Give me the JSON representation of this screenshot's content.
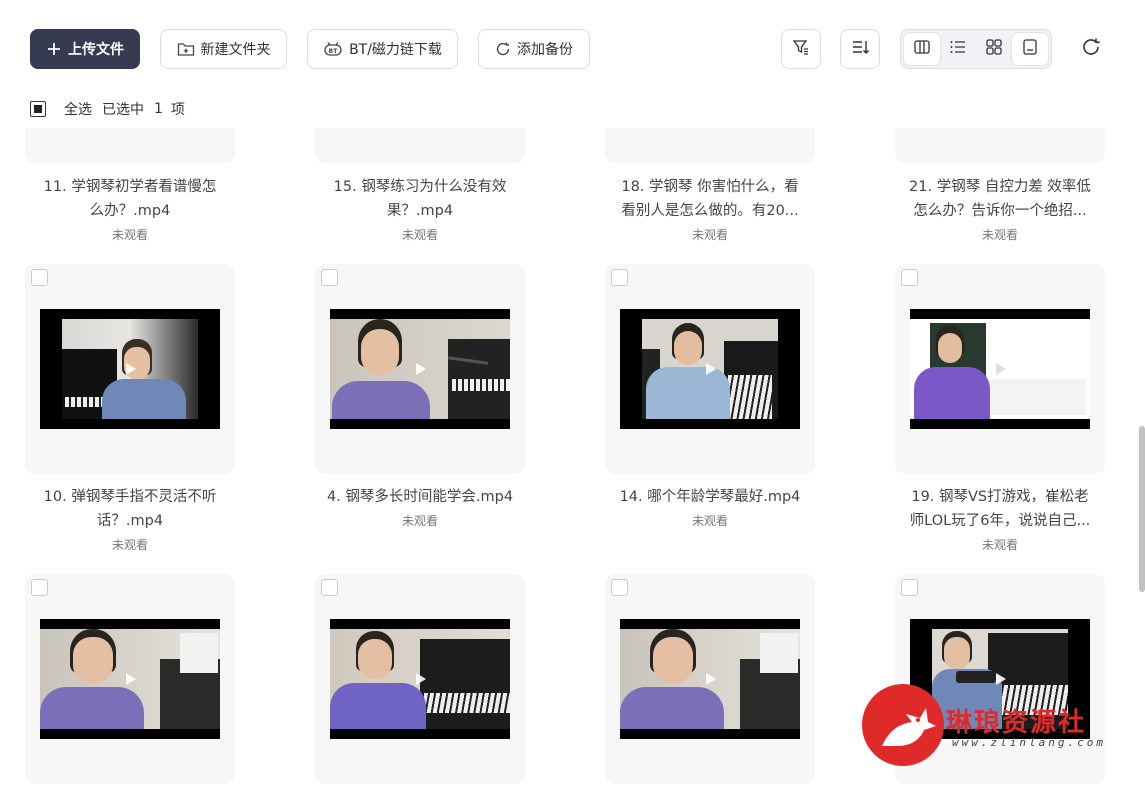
{
  "toolbar": {
    "upload_label": "上传文件",
    "new_folder_label": "新建文件夹",
    "bt_download_label": "BT/磁力链下载",
    "add_backup_label": "添加备份",
    "upload_icon": "plus-icon",
    "new_folder_icon": "folder-plus-icon",
    "bt_icon": "bt-icon",
    "backup_icon": "sync-icon"
  },
  "selection": {
    "select_all_label": "全选",
    "selected_prefix": "已选中",
    "selected_count": "1",
    "selected_suffix": "项"
  },
  "videos": [
    {
      "name": "11. 学钢琴初学者看谱慢怎么办？.mp4",
      "line1": "11. 学钢琴初学者看谱慢怎",
      "line2": "么办？.mp4",
      "status": "未观看"
    },
    {
      "name": "15. 钢琴练习为什么没有效果？.mp4",
      "line1": "15. 钢琴练习为什么没有效",
      "line2": "果？.mp4",
      "status": "未观看"
    },
    {
      "name": "18. 学钢琴 你害怕什么，看看别人是怎么做的。有20...",
      "line1": "18. 学钢琴 你害怕什么，看",
      "line2": "看别人是怎么做的。有20...",
      "status": "未观看"
    },
    {
      "name": "21. 学钢琴 自控力差 效率低怎么办？告诉你一个绝招...",
      "line1": "21. 学钢琴 自控力差 效率低",
      "line2": "怎么办？告诉你一个绝招...",
      "status": "未观看"
    },
    {
      "name": "10. 弹钢琴手指不灵活不听话？.mp4",
      "line1": "10. 弹钢琴手指不灵活不听",
      "line2": "话？.mp4",
      "status": "未观看"
    },
    {
      "name": "4. 钢琴多长时间能学会.mp4",
      "line1": "4. 钢琴多长时间能学会.mp4",
      "line2": "",
      "status": "未观看"
    },
    {
      "name": "14. 哪个年龄学琴最好.mp4",
      "line1": "14. 哪个年龄学琴最好.mp4",
      "line2": "",
      "status": "未观看"
    },
    {
      "name": "19. 钢琴VS打游戏，崔松老师LOL玩了6年，说说自己...",
      "line1": "19. 钢琴VS打游戏，崔松老",
      "line2": "师LOL玩了6年，说说自己...",
      "status": "未观看"
    }
  ],
  "watermark": {
    "text": "琳琅资源社",
    "url": "www.zlinlang.com"
  },
  "colors": {
    "primary_button": "#363b52",
    "card_bg": "#f7f7f8",
    "watermark_red": "#e02a2a"
  }
}
